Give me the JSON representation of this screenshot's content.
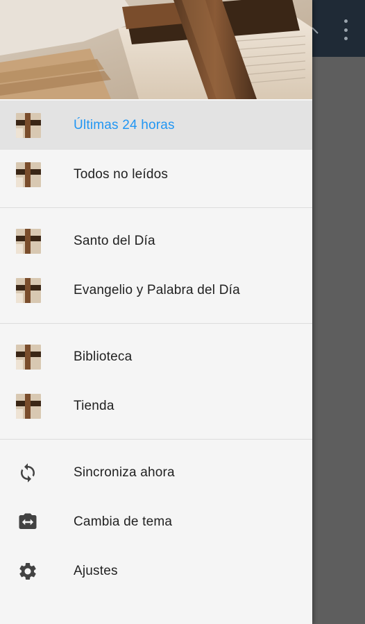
{
  "appbar": {
    "overflow_icon": "more-vert-icon",
    "partial_icon": "search-icon"
  },
  "drawer": {
    "header_image": "open-bible-with-wooden-cross",
    "sections": [
      {
        "items": [
          {
            "label": "Últimas 24 horas",
            "icon": "feed-thumbnail",
            "active": true
          },
          {
            "label": "Todos no leídos",
            "icon": "feed-thumbnail",
            "active": false
          }
        ]
      },
      {
        "items": [
          {
            "label": "Santo del Día",
            "icon": "feed-thumbnail"
          },
          {
            "label": "Evangelio y Palabra del Día",
            "icon": "feed-thumbnail"
          }
        ]
      },
      {
        "items": [
          {
            "label": "Biblioteca",
            "icon": "feed-thumbnail"
          },
          {
            "label": "Tienda",
            "icon": "feed-thumbnail"
          }
        ]
      },
      {
        "items": [
          {
            "label": "Sincroniza ahora",
            "icon": "sync-icon"
          },
          {
            "label": "Cambia de tema",
            "icon": "switch-theme-icon"
          },
          {
            "label": "Ajustes",
            "icon": "settings-icon"
          }
        ]
      }
    ]
  },
  "colors": {
    "accent": "#2196f3",
    "appbar": "#1f2a36",
    "drawer_bg": "#f5f5f5",
    "active_bg": "#e3e3e3",
    "scrim": "#5e5e5e"
  }
}
